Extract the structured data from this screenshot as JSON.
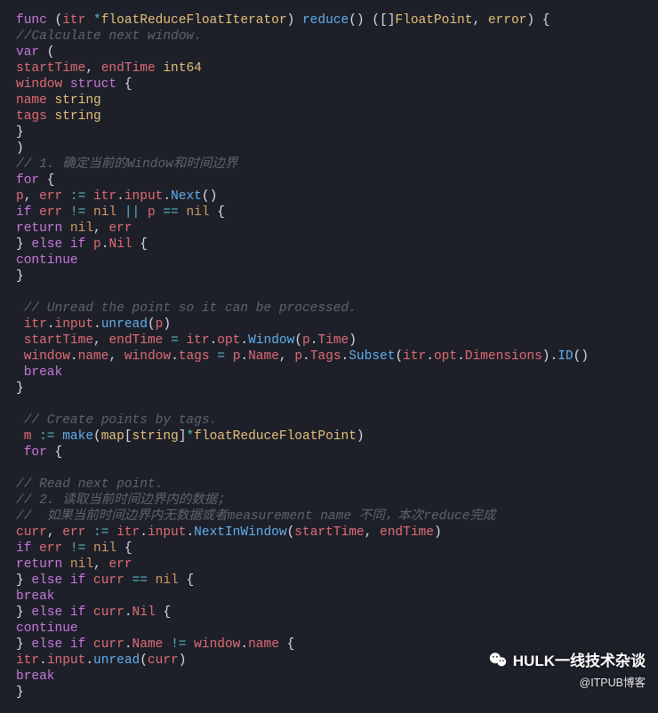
{
  "code": {
    "lines": [
      [
        [
          "kw",
          "func"
        ],
        [
          "pun",
          " ("
        ],
        [
          "id",
          "itr"
        ],
        [
          "pun",
          " "
        ],
        [
          "op",
          "*"
        ],
        [
          "type",
          "floatReduceFloatIterator"
        ],
        [
          "pun",
          ") "
        ],
        [
          "fn",
          "reduce"
        ],
        [
          "pun",
          "() (["
        ],
        [
          "pun",
          "]"
        ],
        [
          "type",
          "FloatPoint"
        ],
        [
          "pun",
          ", "
        ],
        [
          "type",
          "error"
        ],
        [
          "pun",
          ") {"
        ]
      ],
      [
        [
          "cmt",
          "//Calculate next window."
        ]
      ],
      [
        [
          "kw",
          "var"
        ],
        [
          "pun",
          " ("
        ]
      ],
      [
        [
          "id",
          "startTime"
        ],
        [
          "pun",
          ", "
        ],
        [
          "id",
          "endTime"
        ],
        [
          "pun",
          " "
        ],
        [
          "type",
          "int64"
        ]
      ],
      [
        [
          "id",
          "window"
        ],
        [
          "pun",
          " "
        ],
        [
          "kw",
          "struct"
        ],
        [
          "pun",
          " {"
        ]
      ],
      [
        [
          "id",
          "name"
        ],
        [
          "pun",
          " "
        ],
        [
          "type",
          "string"
        ]
      ],
      [
        [
          "id",
          "tags"
        ],
        [
          "pun",
          " "
        ],
        [
          "type",
          "string"
        ]
      ],
      [
        [
          "pun",
          "}"
        ]
      ],
      [
        [
          "pun",
          ")"
        ]
      ],
      [
        [
          "cmt",
          "// 1. 确定当前的Window和时间边界"
        ]
      ],
      [
        [
          "kw",
          "for"
        ],
        [
          "pun",
          " {"
        ]
      ],
      [
        [
          "id",
          "p"
        ],
        [
          "pun",
          ", "
        ],
        [
          "id",
          "err"
        ],
        [
          "pun",
          " "
        ],
        [
          "op",
          ":="
        ],
        [
          "pun",
          " "
        ],
        [
          "id",
          "itr"
        ],
        [
          "pun",
          "."
        ],
        [
          "id",
          "input"
        ],
        [
          "pun",
          "."
        ],
        [
          "fn",
          "Next"
        ],
        [
          "pun",
          "()"
        ]
      ],
      [
        [
          "kw",
          "if"
        ],
        [
          "pun",
          " "
        ],
        [
          "id",
          "err"
        ],
        [
          "pun",
          " "
        ],
        [
          "op",
          "!="
        ],
        [
          "pun",
          " "
        ],
        [
          "nil",
          "nil"
        ],
        [
          "pun",
          " "
        ],
        [
          "op",
          "||"
        ],
        [
          "pun",
          " "
        ],
        [
          "id",
          "p"
        ],
        [
          "pun",
          " "
        ],
        [
          "op",
          "=="
        ],
        [
          "pun",
          " "
        ],
        [
          "nil",
          "nil"
        ],
        [
          "pun",
          " {"
        ]
      ],
      [
        [
          "kw",
          "return"
        ],
        [
          "pun",
          " "
        ],
        [
          "nil",
          "nil"
        ],
        [
          "pun",
          ", "
        ],
        [
          "id",
          "err"
        ]
      ],
      [
        [
          "pun",
          "} "
        ],
        [
          "kw",
          "else"
        ],
        [
          "pun",
          " "
        ],
        [
          "kw",
          "if"
        ],
        [
          "pun",
          " "
        ],
        [
          "id",
          "p"
        ],
        [
          "pun",
          "."
        ],
        [
          "id",
          "Nil"
        ],
        [
          "pun",
          " {"
        ]
      ],
      [
        [
          "kw",
          "continue"
        ]
      ],
      [
        [
          "pun",
          "}"
        ]
      ],
      [
        [
          "pun",
          ""
        ]
      ],
      [
        [
          "cmt",
          " // Unread the point so it can be processed."
        ]
      ],
      [
        [
          "pun",
          " "
        ],
        [
          "id",
          "itr"
        ],
        [
          "pun",
          "."
        ],
        [
          "id",
          "input"
        ],
        [
          "pun",
          "."
        ],
        [
          "fn",
          "unread"
        ],
        [
          "pun",
          "("
        ],
        [
          "id",
          "p"
        ],
        [
          "pun",
          ")"
        ]
      ],
      [
        [
          "pun",
          " "
        ],
        [
          "id",
          "startTime"
        ],
        [
          "pun",
          ", "
        ],
        [
          "id",
          "endTime"
        ],
        [
          "pun",
          " "
        ],
        [
          "op",
          "="
        ],
        [
          "pun",
          " "
        ],
        [
          "id",
          "itr"
        ],
        [
          "pun",
          "."
        ],
        [
          "id",
          "opt"
        ],
        [
          "pun",
          "."
        ],
        [
          "fn",
          "Window"
        ],
        [
          "pun",
          "("
        ],
        [
          "id",
          "p"
        ],
        [
          "pun",
          "."
        ],
        [
          "id",
          "Time"
        ],
        [
          "pun",
          ")"
        ]
      ],
      [
        [
          "pun",
          " "
        ],
        [
          "id",
          "window"
        ],
        [
          "pun",
          "."
        ],
        [
          "id",
          "name"
        ],
        [
          "pun",
          ", "
        ],
        [
          "id",
          "window"
        ],
        [
          "pun",
          "."
        ],
        [
          "id",
          "tags"
        ],
        [
          "pun",
          " "
        ],
        [
          "op",
          "="
        ],
        [
          "pun",
          " "
        ],
        [
          "id",
          "p"
        ],
        [
          "pun",
          "."
        ],
        [
          "id",
          "Name"
        ],
        [
          "pun",
          ", "
        ],
        [
          "id",
          "p"
        ],
        [
          "pun",
          "."
        ],
        [
          "id",
          "Tags"
        ],
        [
          "pun",
          "."
        ],
        [
          "fn",
          "Subset"
        ],
        [
          "pun",
          "("
        ],
        [
          "id",
          "itr"
        ],
        [
          "pun",
          "."
        ],
        [
          "id",
          "opt"
        ],
        [
          "pun",
          "."
        ],
        [
          "id",
          "Dimensions"
        ],
        [
          "pun",
          ")."
        ],
        [
          "fn",
          "ID"
        ],
        [
          "pun",
          "()"
        ]
      ],
      [
        [
          "pun",
          " "
        ],
        [
          "kw",
          "break"
        ]
      ],
      [
        [
          "pun",
          "}"
        ]
      ],
      [
        [
          "pun",
          ""
        ]
      ],
      [
        [
          "cmt",
          " // Create points by tags."
        ]
      ],
      [
        [
          "pun",
          " "
        ],
        [
          "id",
          "m"
        ],
        [
          "pun",
          " "
        ],
        [
          "op",
          ":="
        ],
        [
          "pun",
          " "
        ],
        [
          "fn",
          "make"
        ],
        [
          "pun",
          "("
        ],
        [
          "type",
          "map"
        ],
        [
          "pun",
          "["
        ],
        [
          "type",
          "string"
        ],
        [
          "pun",
          "]"
        ],
        [
          "op",
          "*"
        ],
        [
          "type",
          "floatReduceFloatPoint"
        ],
        [
          "pun",
          ")"
        ]
      ],
      [
        [
          "pun",
          " "
        ],
        [
          "kw",
          "for"
        ],
        [
          "pun",
          " {"
        ]
      ],
      [
        [
          "pun",
          ""
        ]
      ],
      [
        [
          "cmt",
          "// Read next point."
        ]
      ],
      [
        [
          "cmt",
          "// 2. 读取当前时间边界内的数据；"
        ]
      ],
      [
        [
          "cmt",
          "//  如果当前时间边界内无数据或者measurement name 不同，本次reduce完成"
        ]
      ],
      [
        [
          "id",
          "curr"
        ],
        [
          "pun",
          ", "
        ],
        [
          "id",
          "err"
        ],
        [
          "pun",
          " "
        ],
        [
          "op",
          ":="
        ],
        [
          "pun",
          " "
        ],
        [
          "id",
          "itr"
        ],
        [
          "pun",
          "."
        ],
        [
          "id",
          "input"
        ],
        [
          "pun",
          "."
        ],
        [
          "fn",
          "NextInWindow"
        ],
        [
          "pun",
          "("
        ],
        [
          "id",
          "startTime"
        ],
        [
          "pun",
          ", "
        ],
        [
          "id",
          "endTime"
        ],
        [
          "pun",
          ")"
        ]
      ],
      [
        [
          "kw",
          "if"
        ],
        [
          "pun",
          " "
        ],
        [
          "id",
          "err"
        ],
        [
          "pun",
          " "
        ],
        [
          "op",
          "!="
        ],
        [
          "pun",
          " "
        ],
        [
          "nil",
          "nil"
        ],
        [
          "pun",
          " {"
        ]
      ],
      [
        [
          "kw",
          "return"
        ],
        [
          "pun",
          " "
        ],
        [
          "nil",
          "nil"
        ],
        [
          "pun",
          ", "
        ],
        [
          "id",
          "err"
        ]
      ],
      [
        [
          "pun",
          "} "
        ],
        [
          "kw",
          "else"
        ],
        [
          "pun",
          " "
        ],
        [
          "kw",
          "if"
        ],
        [
          "pun",
          " "
        ],
        [
          "id",
          "curr"
        ],
        [
          "pun",
          " "
        ],
        [
          "op",
          "=="
        ],
        [
          "pun",
          " "
        ],
        [
          "nil",
          "nil"
        ],
        [
          "pun",
          " {"
        ]
      ],
      [
        [
          "kw",
          "break"
        ]
      ],
      [
        [
          "pun",
          "} "
        ],
        [
          "kw",
          "else"
        ],
        [
          "pun",
          " "
        ],
        [
          "kw",
          "if"
        ],
        [
          "pun",
          " "
        ],
        [
          "id",
          "curr"
        ],
        [
          "pun",
          "."
        ],
        [
          "id",
          "Nil"
        ],
        [
          "pun",
          " {"
        ]
      ],
      [
        [
          "kw",
          "continue"
        ]
      ],
      [
        [
          "pun",
          "} "
        ],
        [
          "kw",
          "else"
        ],
        [
          "pun",
          " "
        ],
        [
          "kw",
          "if"
        ],
        [
          "pun",
          " "
        ],
        [
          "id",
          "curr"
        ],
        [
          "pun",
          "."
        ],
        [
          "id",
          "Name"
        ],
        [
          "pun",
          " "
        ],
        [
          "op",
          "!="
        ],
        [
          "pun",
          " "
        ],
        [
          "id",
          "window"
        ],
        [
          "pun",
          "."
        ],
        [
          "id",
          "name"
        ],
        [
          "pun",
          " {"
        ]
      ],
      [
        [
          "id",
          "itr"
        ],
        [
          "pun",
          "."
        ],
        [
          "id",
          "input"
        ],
        [
          "pun",
          "."
        ],
        [
          "fn",
          "unread"
        ],
        [
          "pun",
          "("
        ],
        [
          "id",
          "curr"
        ],
        [
          "pun",
          ")"
        ]
      ],
      [
        [
          "kw",
          "break"
        ]
      ],
      [
        [
          "pun",
          "}"
        ]
      ]
    ]
  },
  "watermark": {
    "line1": "HULK一线技术杂谈",
    "line2": "@ITPUB博客"
  }
}
